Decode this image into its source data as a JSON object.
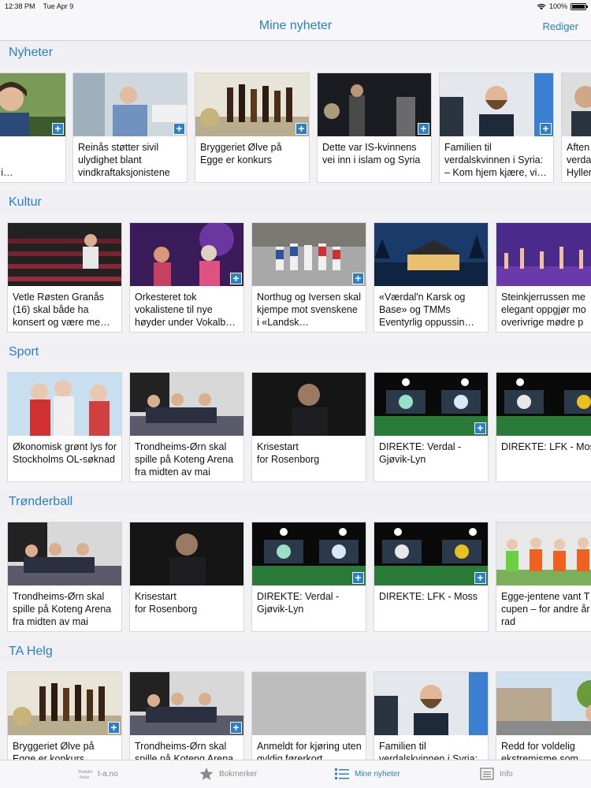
{
  "status": {
    "time": "12:38 PM",
    "date": "Tue Apr 9",
    "battery": "100%",
    "battery_level": 1.0
  },
  "header": {
    "title": "Mine nyheter",
    "edit_label": "Rediger"
  },
  "sections": [
    {
      "title": "Nyheter",
      "cards": [
        {
          "headline": "voldelig\nme som\nS-sakene i…"
        },
        {
          "headline": "Reinås støtter sivil ulydighet blant vindkraftaksjonistene"
        },
        {
          "headline": "Bryggeriet Ølve på Egge er konkurs"
        },
        {
          "headline": "Dette var IS-kvinnens vei inn i islam og Syria"
        },
        {
          "headline": "Familien til verdalskvinnen i Syria: – Kom hjem kjære, vi…"
        },
        {
          "headline": "Aften\nverda\nHyller"
        }
      ]
    },
    {
      "title": "Kultur",
      "cards": [
        {
          "headline": "Vetle Røsten Granås (16) skal både ha konsert og være me…"
        },
        {
          "headline": "Orkesteret tok vokalistene til nye høyder under Vokalb…"
        },
        {
          "headline": "Northug og Iversen skal kjempe mot svenskene i «Landsk…"
        },
        {
          "headline": "«Værdal'n Karsk og Base» og TMMs Eventyrlig oppussin…"
        },
        {
          "headline": "Steinkjerrussen me elegant oppgjør mo overivrige mødre p"
        }
      ]
    },
    {
      "title": "Sport",
      "cards": [
        {
          "headline": "Økonomisk grønt lys for Stockholms OL-søknad"
        },
        {
          "headline": "Trondheims-Ørn skal spille på Koteng Arena fra midten av mai"
        },
        {
          "headline": "Krisestart\nfor Rosenborg"
        },
        {
          "headline": "DIREKTE: Verdal - Gjøvik-Lyn"
        },
        {
          "headline": "DIREKTE: LFK - Mos"
        }
      ]
    },
    {
      "title": "Trønderball",
      "cards": [
        {
          "headline": "Trondheims-Ørn skal spille på Koteng Arena fra midten av mai"
        },
        {
          "headline": "Krisestart\nfor Rosenborg"
        },
        {
          "headline": "DIREKTE: Verdal - Gjøvik-Lyn"
        },
        {
          "headline": "DIREKTE: LFK - Moss"
        },
        {
          "headline": "Egge-jentene vant T cupen – for andre år på rad"
        }
      ]
    },
    {
      "title": "TA Helg",
      "cards": [
        {
          "headline": "Bryggeriet Ølve på Egge er konkurs"
        },
        {
          "headline": "Trondheims-Ørn skal spille på Koteng Arena"
        },
        {
          "headline": "Anmeldt for kjøring uten gyldig førerkort"
        },
        {
          "headline": "Familien til verdalskvinnen i Syria:"
        },
        {
          "headline": "Redd for voldelig ekstremisme som"
        }
      ]
    }
  ],
  "tabs": [
    {
      "label": "t-a.no",
      "icon": "trondelag-avisa-logo-icon"
    },
    {
      "label": "Bokmerker",
      "icon": "star-icon"
    },
    {
      "label": "Mine nyheter",
      "icon": "list-icon"
    },
    {
      "label": "Info",
      "icon": "info-icon"
    }
  ],
  "colors": {
    "accent": "#2a7fc6",
    "plus_badge": "#2a7fc6",
    "background": "#efeff4"
  }
}
